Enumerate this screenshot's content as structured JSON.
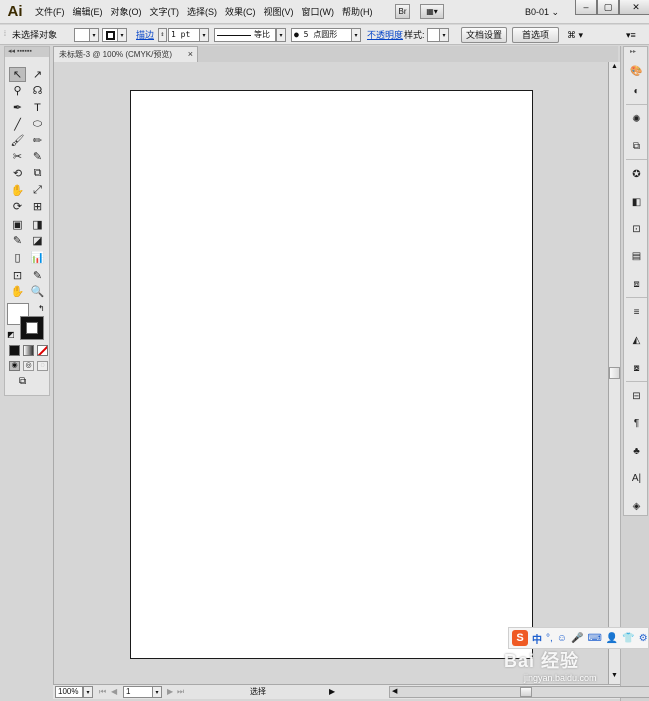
{
  "app": {
    "logo": "Ai"
  },
  "menubar": {
    "items": [
      "文件(F)",
      "编辑(E)",
      "对象(O)",
      "文字(T)",
      "选择(S)",
      "效果(C)",
      "视图(V)",
      "窗口(W)",
      "帮助(H)"
    ],
    "workspace": "B0-01",
    "workspace_arrow": "⌄",
    "bridge_icon": "Br",
    "arrange_icon": "▦▾",
    "window_buttons": {
      "minimize": "–",
      "restore": "▢",
      "close": "✕"
    }
  },
  "controlbar": {
    "selection_label": "未选择对象",
    "stroke_link": "描边",
    "stroke_weight": "1 pt",
    "stroke_profile": "等比",
    "brush": "● 5 点圆形",
    "opacity_link": "不透明度",
    "style_label": "样式:",
    "doc_setup_button": "文档设置",
    "prefs_button": "首选项",
    "arrange_label": "⌘ ▾",
    "panel_menu": "▾≡"
  },
  "document": {
    "tab_title": "未标题-3 @ 100% (CMYK/预览)",
    "tab_close": "×"
  },
  "toolbox": {
    "grip": "◂◂ ▪▪▪▪▪▪",
    "tools": [
      "↖",
      "↗",
      "⚲",
      "☊",
      "✒",
      "T",
      "╱",
      "⬭",
      "🖌",
      "✏",
      "✂",
      "✎",
      "⟲",
      "⧉",
      "✋",
      "⤢",
      "⟳",
      "⊞",
      "▣",
      "◨",
      "✎",
      "◪",
      "▯",
      "📊",
      "⊡",
      "✎",
      "✋",
      "🔍"
    ]
  },
  "statusbar": {
    "zoom": "100%",
    "page": "1",
    "status_text": "选择",
    "nav_first": "⏮",
    "nav_prev": "◀",
    "nav_next": "▶",
    "nav_last": "⏭"
  },
  "watermark": {
    "sogou": "S",
    "sogou_bar": [
      "中",
      "°,",
      "☺",
      "🎤",
      "⌨",
      "👤",
      "👕",
      "⚙"
    ],
    "baidu_text": "Bai 经验",
    "baidu_url": "jingyan.baidu.com"
  }
}
